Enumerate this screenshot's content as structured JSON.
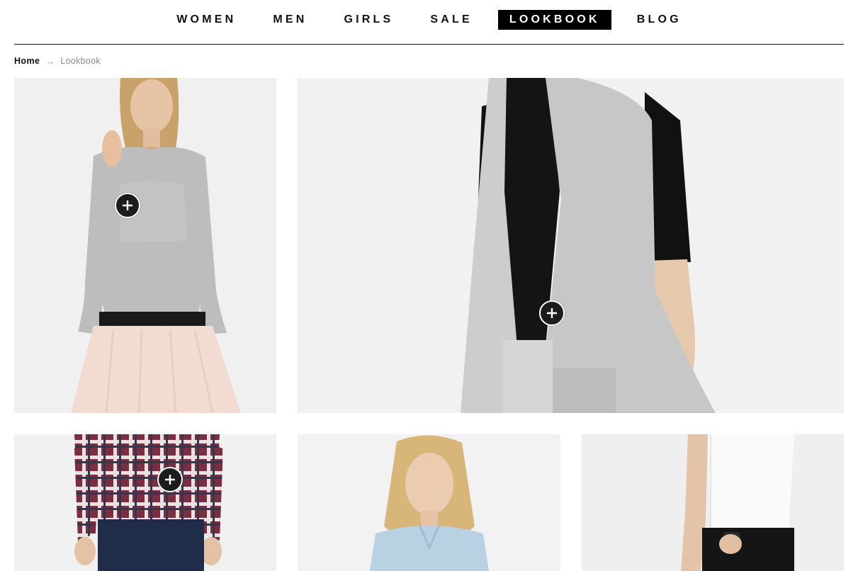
{
  "nav": {
    "items": [
      {
        "label": "WOMEN",
        "active": false
      },
      {
        "label": "MEN",
        "active": false
      },
      {
        "label": "GIRLS",
        "active": false
      },
      {
        "label": "SALE",
        "active": false
      },
      {
        "label": "LOOKBOOK",
        "active": true
      },
      {
        "label": "BLOG",
        "active": false
      }
    ]
  },
  "breadcrumb": {
    "home": "Home",
    "separator": "→",
    "current": "Lookbook"
  },
  "lookbook": {
    "tiles": [
      {
        "subject": "woman in grey sweatshirt and pink tulle skirt",
        "has_hotspot": true
      },
      {
        "subject": "grey sleeveless long vest over black tee",
        "has_hotspot": true
      },
      {
        "subject": "plaid flannel shirt with navy trousers",
        "has_hotspot": true
      },
      {
        "subject": "woman in light blue denim shirt",
        "has_hotspot": false
      },
      {
        "subject": "white tee with black jeans and watch",
        "has_hotspot": false
      }
    ]
  },
  "colors": {
    "text": "#111111",
    "active_bg": "#000000",
    "active_text": "#ffffff",
    "breadcrumb_muted": "#8b8b8b",
    "hotspot": "#1c1c1c"
  }
}
